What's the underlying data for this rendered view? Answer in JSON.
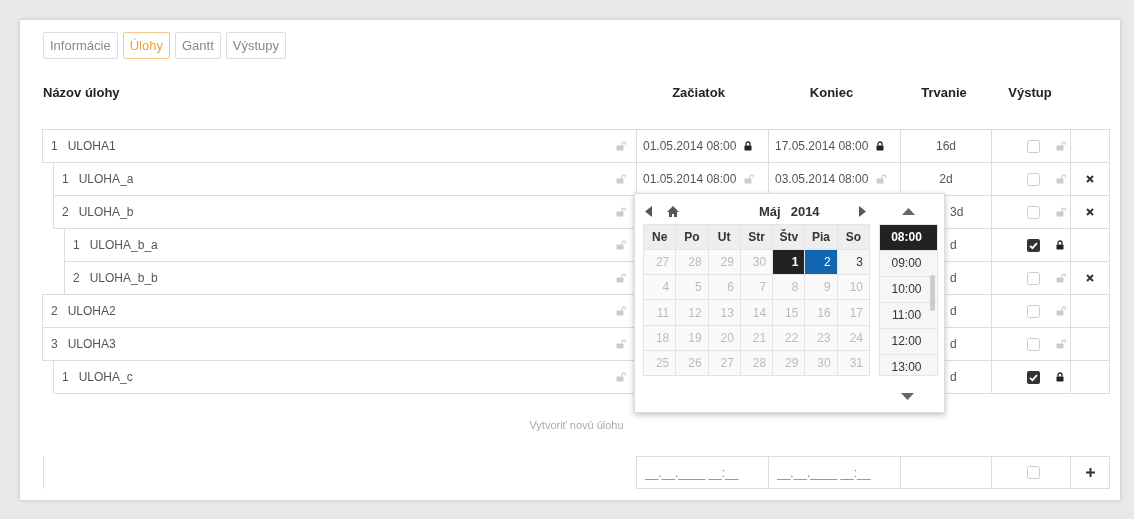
{
  "tabs": [
    {
      "label": "Informácie",
      "selected": false
    },
    {
      "label": "Úlohy",
      "selected": true
    },
    {
      "label": "Gantt",
      "selected": false
    },
    {
      "label": "Výstupy",
      "selected": false
    }
  ],
  "columns": [
    "Názov úlohy",
    "Začiatok",
    "Koniec",
    "Trvanie",
    "Výstup"
  ],
  "tasks": [
    {
      "number": "1",
      "name": "ULOHA1",
      "name_locked": false,
      "start": "01.05.2014 08:00",
      "start_locked": true,
      "end": "17.05.2014 08:00",
      "end_locked": true,
      "duration": "16d",
      "output": false,
      "output_locked": false,
      "deletable": false,
      "children": [
        {
          "number": "1",
          "name": "ULOHA_a",
          "name_locked": false,
          "start": "01.05.2014 08:00",
          "start_locked": false,
          "end": "03.05.2014 08:00",
          "end_locked": false,
          "duration": "2d",
          "output": false,
          "output_locked": false,
          "deletable": true
        },
        {
          "number": "2",
          "name": "ULOHA_b",
          "name_locked": false,
          "duration": "3d",
          "output": false,
          "output_locked": false,
          "deletable": true,
          "children": [
            {
              "number": "1",
              "name": "ULOHA_b_a",
              "name_locked": false,
              "duration": "d",
              "output": true,
              "output_locked": true,
              "deletable": false
            },
            {
              "number": "2",
              "name": "ULOHA_b_b",
              "name_locked": false,
              "duration": "d",
              "output": false,
              "output_locked": false,
              "deletable": true
            }
          ]
        }
      ]
    },
    {
      "number": "2",
      "name": "ULOHA2",
      "name_locked": false,
      "duration": "d",
      "output": false,
      "output_locked": false,
      "deletable": false
    },
    {
      "number": "3",
      "name": "ULOHA3",
      "name_locked": false,
      "duration": "d",
      "output": false,
      "output_locked": false,
      "deletable": false,
      "children": [
        {
          "number": "1",
          "name": "ULOHA_c",
          "name_locked": false,
          "duration": "d",
          "output": true,
          "output_locked": true,
          "deletable": false
        }
      ]
    }
  ],
  "date_picker": {
    "month": "Máj",
    "year": "2014",
    "weekdays": [
      "Ne",
      "Po",
      "Ut",
      "Str",
      "Štv",
      "Pia",
      "So"
    ],
    "weeks": [
      [
        {
          "label": "27",
          "disabled": true,
          "selected": false,
          "today": false
        },
        {
          "label": "28",
          "disabled": true,
          "selected": false,
          "today": false
        },
        {
          "label": "29",
          "disabled": true,
          "selected": false,
          "today": false
        },
        {
          "label": "30",
          "disabled": true,
          "selected": false,
          "today": false
        },
        {
          "label": "1",
          "disabled": false,
          "selected": true,
          "today": false
        },
        {
          "label": "2",
          "disabled": false,
          "selected": false,
          "today": true
        },
        {
          "label": "3",
          "disabled": false,
          "selected": false,
          "today": false
        }
      ],
      [
        {
          "label": "4",
          "disabled": true,
          "selected": false,
          "today": false
        },
        {
          "label": "5",
          "disabled": true,
          "selected": false,
          "today": false
        },
        {
          "label": "6",
          "disabled": true,
          "selected": false,
          "today": false
        },
        {
          "label": "7",
          "disabled": true,
          "selected": false,
          "today": false
        },
        {
          "label": "8",
          "disabled": true,
          "selected": false,
          "today": false
        },
        {
          "label": "9",
          "disabled": true,
          "selected": false,
          "today": false
        },
        {
          "label": "10",
          "disabled": true,
          "selected": false,
          "today": false
        }
      ],
      [
        {
          "label": "11",
          "disabled": true,
          "selected": false,
          "today": false
        },
        {
          "label": "12",
          "disabled": true,
          "selected": false,
          "today": false
        },
        {
          "label": "13",
          "disabled": true,
          "selected": false,
          "today": false
        },
        {
          "label": "14",
          "disabled": true,
          "selected": false,
          "today": false
        },
        {
          "label": "15",
          "disabled": true,
          "selected": false,
          "today": false
        },
        {
          "label": "16",
          "disabled": true,
          "selected": false,
          "today": false
        },
        {
          "label": "17",
          "disabled": true,
          "selected": false,
          "today": false
        }
      ],
      [
        {
          "label": "18",
          "disabled": true,
          "selected": false,
          "today": false
        },
        {
          "label": "19",
          "disabled": true,
          "selected": false,
          "today": false
        },
        {
          "label": "20",
          "disabled": true,
          "selected": false,
          "today": false
        },
        {
          "label": "21",
          "disabled": true,
          "selected": false,
          "today": false
        },
        {
          "label": "22",
          "disabled": true,
          "selected": false,
          "today": false
        },
        {
          "label": "23",
          "disabled": true,
          "selected": false,
          "today": false
        },
        {
          "label": "24",
          "disabled": true,
          "selected": false,
          "today": false
        }
      ],
      [
        {
          "label": "25",
          "disabled": true,
          "selected": false,
          "today": false
        },
        {
          "label": "26",
          "disabled": true,
          "selected": false,
          "today": false
        },
        {
          "label": "27",
          "disabled": true,
          "selected": false,
          "today": false
        },
        {
          "label": "28",
          "disabled": true,
          "selected": false,
          "today": false
        },
        {
          "label": "29",
          "disabled": true,
          "selected": false,
          "today": false
        },
        {
          "label": "30",
          "disabled": true,
          "selected": false,
          "today": false
        },
        {
          "label": "31",
          "disabled": true,
          "selected": false,
          "today": false
        }
      ]
    ],
    "times": [
      {
        "label": "08:00",
        "selected": true
      },
      {
        "label": "09:00",
        "selected": false
      },
      {
        "label": "10:00",
        "selected": false
      },
      {
        "label": "11:00",
        "selected": false
      },
      {
        "label": "12:00",
        "selected": false
      },
      {
        "label": "13:00",
        "selected": false
      }
    ]
  },
  "new_task": {
    "caption": "Vytvoriť novú úlohu",
    "start_placeholder": "__.__.____ __:__",
    "end_placeholder": "__.__.____ __:__",
    "output": false
  }
}
